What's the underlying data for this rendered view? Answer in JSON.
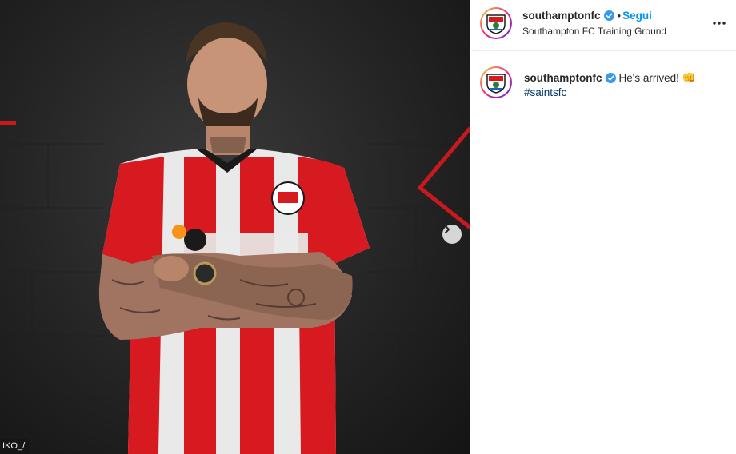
{
  "post": {
    "photo_tag": "IKO_/",
    "next_icon": "chevron-right-icon"
  },
  "header": {
    "username": "southamptonfc",
    "separator": "•",
    "follow_label": "Segui",
    "location": "Southampton FC Training Ground",
    "more_icon": "more-horizontal-icon"
  },
  "caption": {
    "username": "southamptonfc",
    "text": "He's arrived! 👊",
    "hashtag": "#saintsfc"
  },
  "colors": {
    "follow_blue": "#0095f6",
    "hashtag_blue": "#00376b",
    "verified_blue": "#3897f0",
    "kit_red": "#d71920"
  }
}
